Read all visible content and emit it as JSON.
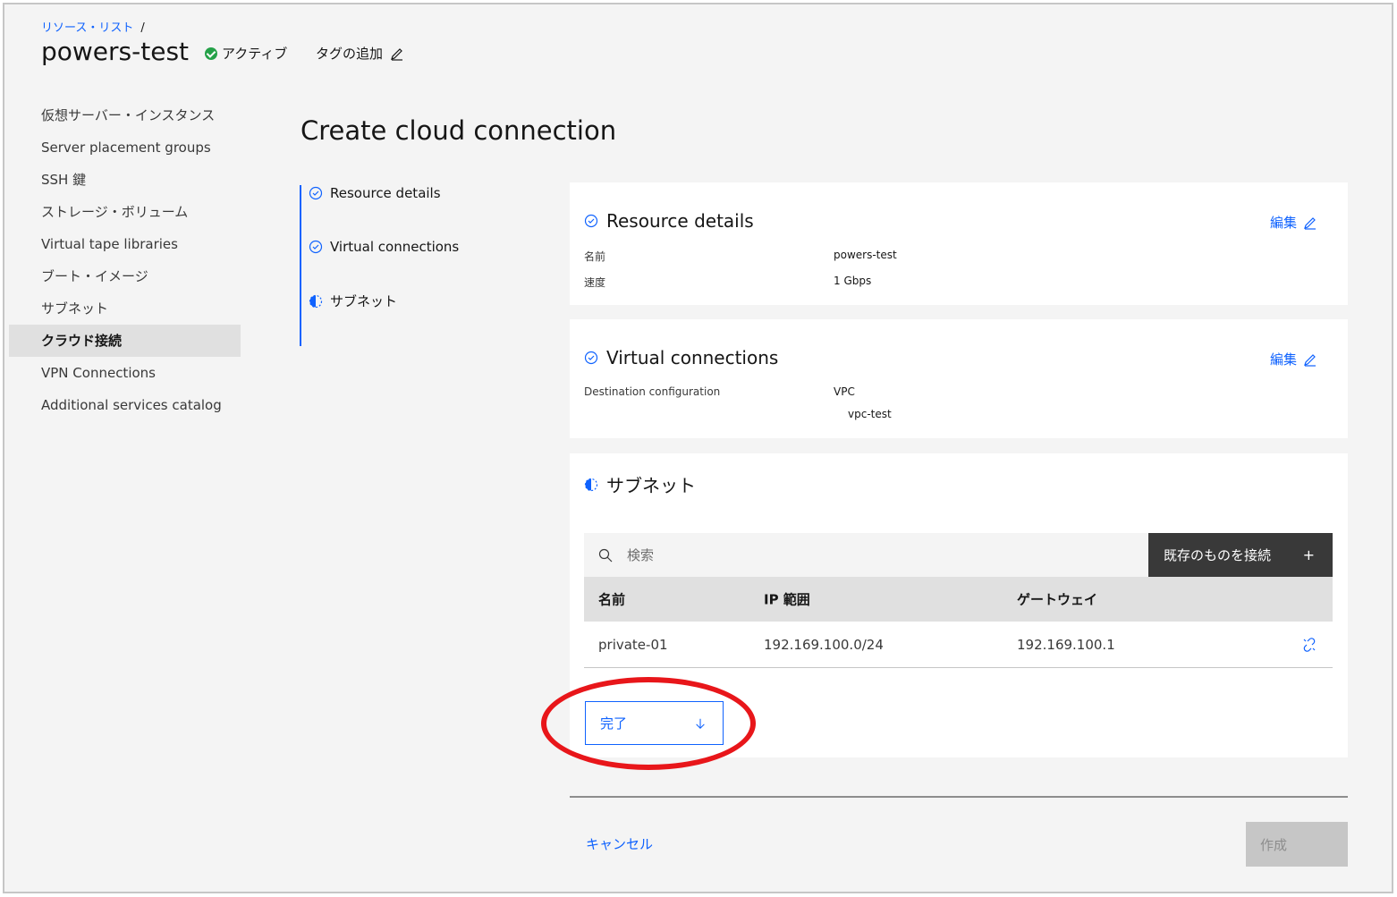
{
  "breadcrumb": {
    "link": "リソース・リスト",
    "separator": "/"
  },
  "header": {
    "title": "powers-test",
    "status": "アクティブ",
    "add_tag": "タグの追加"
  },
  "sidebar": {
    "items": [
      {
        "label": "仮想サーバー・インスタンス"
      },
      {
        "label": "Server placement groups"
      },
      {
        "label": "SSH 鍵"
      },
      {
        "label": "ストレージ・ボリューム"
      },
      {
        "label": "Virtual tape libraries"
      },
      {
        "label": "ブート・イメージ"
      },
      {
        "label": "サブネット"
      },
      {
        "label": "クラウド接続",
        "active": true
      },
      {
        "label": "VPN Connections"
      },
      {
        "label": "Additional services catalog"
      }
    ]
  },
  "main": {
    "title": "Create cloud connection",
    "steps": [
      {
        "label": "Resource details",
        "state": "complete"
      },
      {
        "label": "Virtual connections",
        "state": "complete"
      },
      {
        "label": "サブネット",
        "state": "current"
      }
    ],
    "resource_details": {
      "heading": "Resource details",
      "edit": "編集",
      "name_label": "名前",
      "name_value": "powers-test",
      "speed_label": "速度",
      "speed_value": "1 Gbps"
    },
    "virtual_connections": {
      "heading": "Virtual connections",
      "edit": "編集",
      "dest_label": "Destination configuration",
      "dest_value": "VPC",
      "dest_sub": "vpc-test"
    },
    "subnets": {
      "heading": "サブネット",
      "search_placeholder": "検索",
      "connect_button": "既存のものを接続",
      "columns": [
        "名前",
        "IP 範囲",
        "ゲートウェイ"
      ],
      "rows": [
        {
          "name": "private-01",
          "ip_range": "192.169.100.0/24",
          "gateway": "192.169.100.1"
        }
      ],
      "done_button": "完了"
    },
    "footer": {
      "cancel": "キャンセル",
      "create": "作成"
    }
  },
  "colors": {
    "accent": "#0f62fe",
    "status_active": "#24a148",
    "annotation": "#e8161a"
  }
}
